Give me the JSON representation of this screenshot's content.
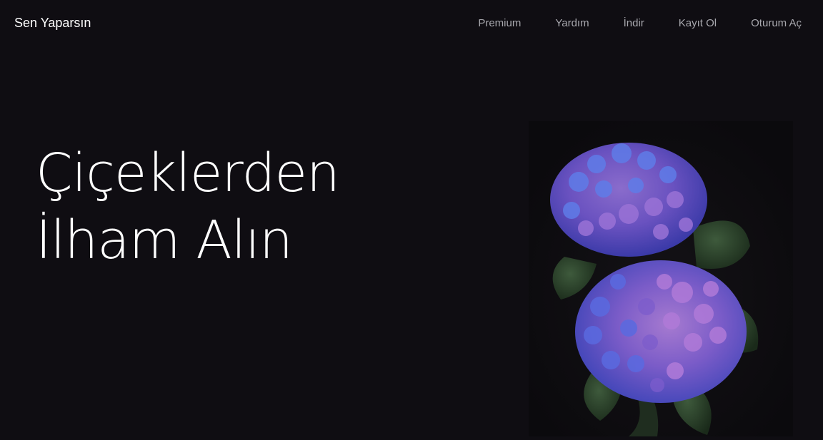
{
  "nav": {
    "brand": "Sen Yaparsın",
    "links": [
      {
        "label": "Premium"
      },
      {
        "label": "Yardım"
      },
      {
        "label": "İndir"
      },
      {
        "label": "Kayıt Ol"
      },
      {
        "label": "Oturum Aç"
      }
    ]
  },
  "hero": {
    "title_line1": "Çiçeklerden",
    "title_line2": "İlham Alın",
    "image": "hydrangea-flower-photo"
  },
  "colors": {
    "background": "#0f0d12",
    "text": "#ffffff",
    "nav_link": "#a8a8ae"
  }
}
